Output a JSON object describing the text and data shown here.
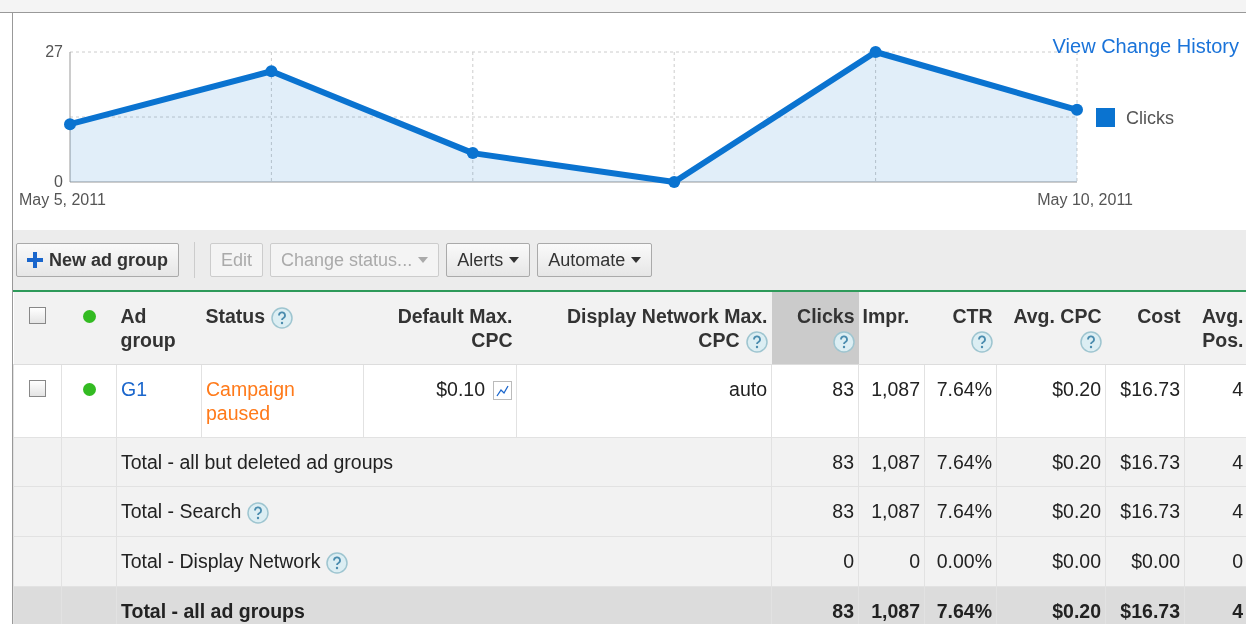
{
  "top_link": "View Change History",
  "chart": {
    "chart_data": {
      "type": "area",
      "categories": [
        "May 5, 2011",
        null,
        null,
        null,
        null,
        "May 10, 2011"
      ],
      "ylim": [
        0,
        27
      ],
      "yticks": [
        0,
        27
      ],
      "grid": true,
      "series": [
        {
          "name": "Clicks",
          "color": "#0a73d0",
          "values": [
            12,
            23,
            6,
            0,
            27,
            15
          ]
        }
      ]
    }
  },
  "toolbar": [
    {
      "label": "New ad group",
      "kind": "add",
      "disabled": false
    },
    {
      "label": "Edit",
      "kind": "plain",
      "disabled": true
    },
    {
      "label": "Change status...",
      "kind": "menu",
      "disabled": true
    },
    {
      "label": "Alerts",
      "kind": "menu",
      "disabled": false
    },
    {
      "label": "Automate",
      "kind": "menu",
      "disabled": false
    }
  ],
  "table": {
    "select_all": {
      "checked": false
    },
    "header_dot": {
      "color": "#33bb22"
    },
    "columns": [
      {
        "label": "Ad group",
        "help": false,
        "selected": false
      },
      {
        "label": "Status",
        "help": true,
        "selected": false
      },
      {
        "label": "Default Max. CPC",
        "help": false,
        "selected": false
      },
      {
        "label": "Display Network Max. CPC",
        "help": true,
        "selected": false
      },
      {
        "label": "Clicks",
        "help": true,
        "selected": true
      },
      {
        "label": "Impr.",
        "help": false,
        "selected": false
      },
      {
        "label": "CTR",
        "help": true,
        "selected": false
      },
      {
        "label": "Avg. CPC",
        "help": true,
        "selected": false
      },
      {
        "label": "Cost",
        "help": false,
        "selected": false
      },
      {
        "label": "Avg. Pos.",
        "help": false,
        "selected": false
      }
    ],
    "rows": [
      {
        "checked": false,
        "color": "#33bb22",
        "name": "G1",
        "status": "Campaign paused",
        "default_cpc": "$0.10",
        "display_cpc": "auto",
        "metrics": [
          "83",
          "1,087",
          "7.64%",
          "$0.20",
          "$16.73",
          "4"
        ]
      }
    ],
    "totals": [
      {
        "label": "Total - all but deleted ad groups",
        "help": false,
        "kind": "total",
        "metrics": [
          "83",
          "1,087",
          "7.64%",
          "$0.20",
          "$16.73",
          "4"
        ]
      },
      {
        "label": "Total - Search",
        "help": true,
        "kind": "total",
        "metrics": [
          "83",
          "1,087",
          "7.64%",
          "$0.20",
          "$16.73",
          "4"
        ]
      },
      {
        "label": "Total - Display Network",
        "help": true,
        "kind": "total",
        "metrics": [
          "0",
          "0",
          "0.00%",
          "$0.00",
          "$0.00",
          "0"
        ]
      },
      {
        "label": "Total - all ad groups",
        "help": false,
        "kind": "grand",
        "metrics": [
          "83",
          "1,087",
          "7.64%",
          "$0.20",
          "$16.73",
          "4"
        ]
      }
    ]
  }
}
